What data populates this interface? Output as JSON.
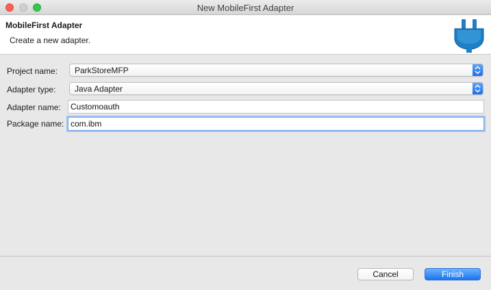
{
  "window": {
    "title": "New MobileFirst Adapter"
  },
  "header": {
    "title": "MobileFirst Adapter",
    "description": "Create a new adapter.",
    "icon": "plug-icon"
  },
  "form": {
    "project_name": {
      "label": "Project name:",
      "value": "ParkStoreMFP"
    },
    "adapter_type": {
      "label": "Adapter type:",
      "value": "Java Adapter"
    },
    "adapter_name": {
      "label": "Adapter name:",
      "value": "Customoauth"
    },
    "package_name": {
      "label": "Package name:",
      "value": "com.ibm"
    }
  },
  "buttons": {
    "cancel": "Cancel",
    "finish": "Finish"
  },
  "colors": {
    "accent": "#1a74f0",
    "icon_blue": "#1f7fc6"
  }
}
